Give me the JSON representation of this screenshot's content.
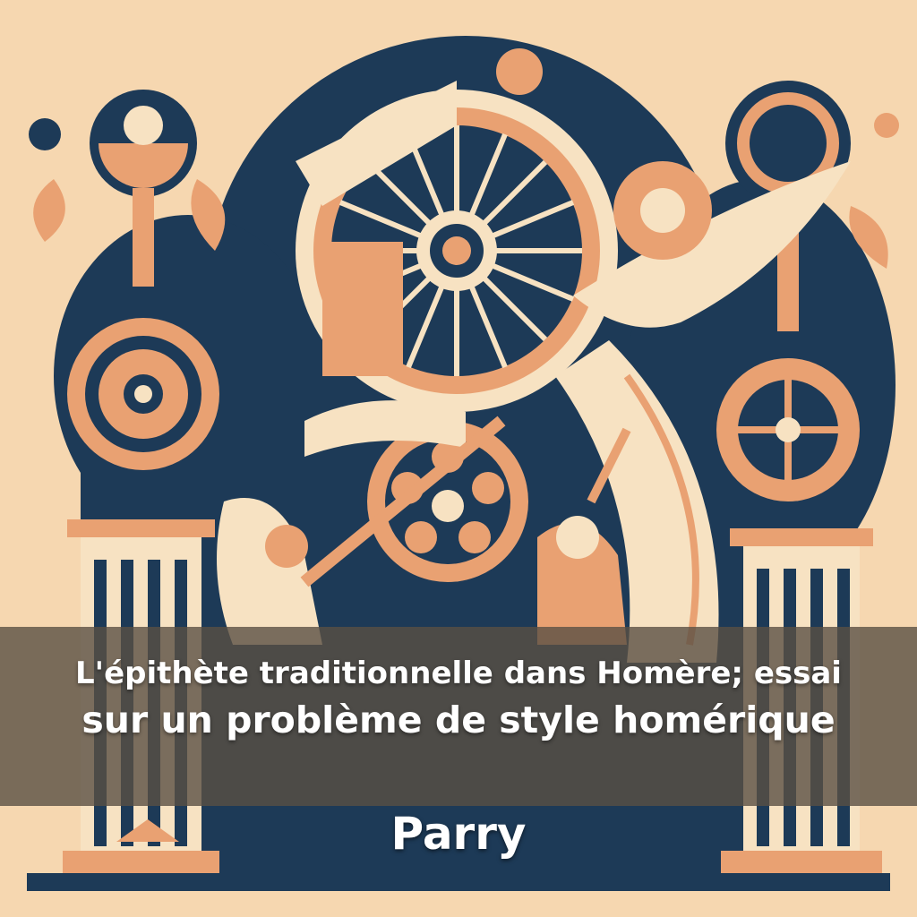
{
  "cover": {
    "title_line1": "L'épithète traditionnelle dans Homère; essai",
    "title_line2": "sur un problème de style homérique",
    "author": "Parry"
  },
  "palette": {
    "background": "#f6d7b0",
    "navy": "#1d3a57",
    "peach": "#e9a172",
    "cream": "#f7e2c2",
    "band": "#5a5044"
  }
}
